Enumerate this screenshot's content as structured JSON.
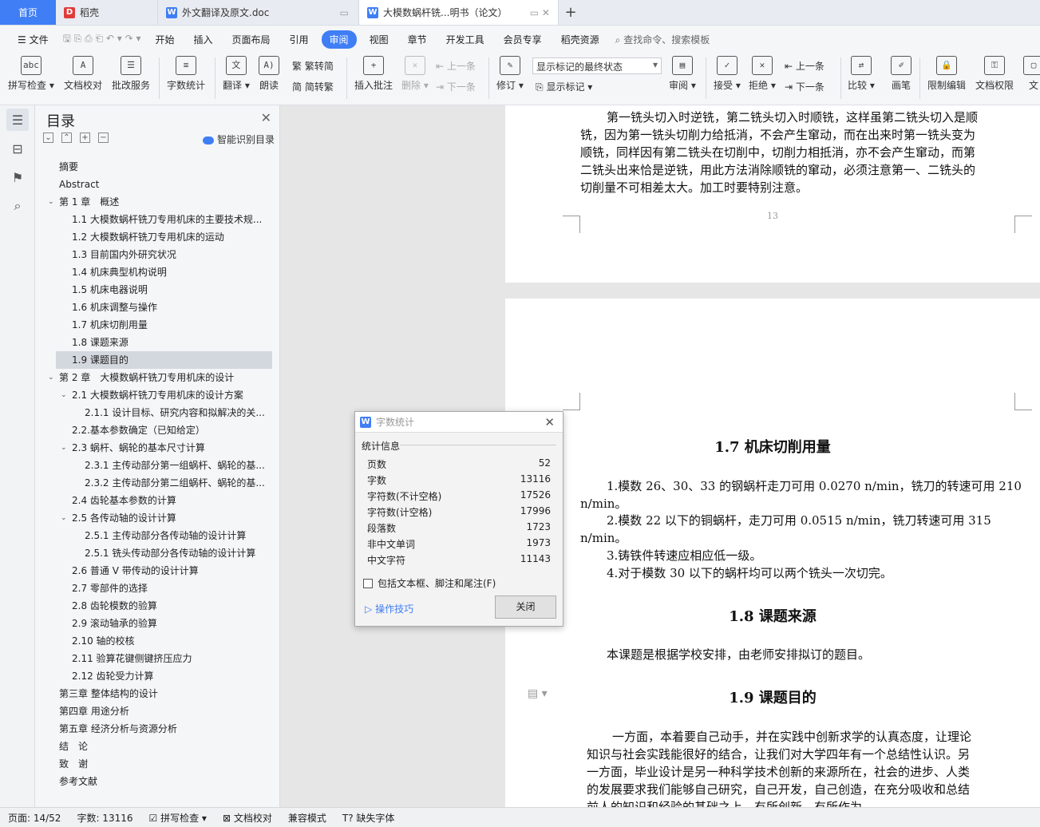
{
  "tabs": {
    "home": "首页",
    "t1": "稻壳",
    "t2": "外文翻译及原文.doc",
    "t3": "大模数蜗杆铣...明书（论文）"
  },
  "menu": [
    "开始",
    "插入",
    "页面布局",
    "引用",
    "审阅",
    "视图",
    "章节",
    "开发工具",
    "会员专享",
    "稻壳资源"
  ],
  "menu_file": "文件",
  "menu_active": "审阅",
  "search_text": "查找命令、搜索模板",
  "toolbar": {
    "spell": "拼写检查",
    "proof": "文档校对",
    "batch": "批改服务",
    "wordcount": "字数统计",
    "translate": "翻译",
    "read": "朗读",
    "trad": "繁转简",
    "simp": "简转繁",
    "insert_comment": "插入批注",
    "delete": "删除",
    "prev": "上一条",
    "next": "下一条",
    "revise": "修订",
    "display_select": "显示标记的最终状态",
    "show_marks": "显示标记",
    "review": "审阅",
    "accept": "接受",
    "reject": "拒绝",
    "prev2": "上一条",
    "next2": "下一条",
    "compare": "比较",
    "ink": "画笔",
    "restrict": "限制编辑",
    "perm": "文档权限",
    "more": "文"
  },
  "toc": {
    "title": "目录",
    "smart": "智能识别目录",
    "items": [
      {
        "t": "摘要",
        "lv": 0
      },
      {
        "t": "Abstract",
        "lv": 0
      },
      {
        "t": "第 1 章　概述",
        "lv": 0,
        "car": true
      },
      {
        "t": "1.1 大模数蜗杆铣刀专用机床的主要技术规...",
        "lv": 1
      },
      {
        "t": "1.2 大模数蜗杆铣刀专用机床的运动",
        "lv": 1
      },
      {
        "t": "1.3 目前国内外研究状况",
        "lv": 1
      },
      {
        "t": "1.4 机床典型机构说明",
        "lv": 1
      },
      {
        "t": "1.5 机床电器说明",
        "lv": 1
      },
      {
        "t": "1.6 机床调整与操作",
        "lv": 1
      },
      {
        "t": "1.7 机床切削用量",
        "lv": 1
      },
      {
        "t": "1.8 课题来源",
        "lv": 1
      },
      {
        "t": "1.9 课题目的",
        "lv": 1,
        "sel": true
      },
      {
        "t": "第 2 章　大模数蜗杆铣刀专用机床的设计",
        "lv": 0,
        "car": true
      },
      {
        "t": "2.1 大模数蜗杆铣刀专用机床的设计方案",
        "lv": 1,
        "car": true
      },
      {
        "t": "2.1.1 设计目标、研究内容和拟解决的关...",
        "lv": 2
      },
      {
        "t": "2.2.基本参数确定（已知给定）",
        "lv": 1
      },
      {
        "t": "2.3 蜗杆、蜗轮的基本尺寸计算",
        "lv": 1,
        "car": true
      },
      {
        "t": "2.3.1 主传动部分第一组蜗杆、蜗轮的基...",
        "lv": 2
      },
      {
        "t": "2.3.2 主传动部分第二组蜗杆、蜗轮的基...",
        "lv": 2
      },
      {
        "t": "2.4 齿轮基本参数的计算",
        "lv": 1
      },
      {
        "t": "2.5 各传动轴的设计计算",
        "lv": 1,
        "car": true
      },
      {
        "t": "2.5.1 主传动部分各传动轴的设计计算",
        "lv": 2
      },
      {
        "t": "2.5.1 铣头传动部分各传动轴的设计计算",
        "lv": 2
      },
      {
        "t": "2.6 普通 V 带传动的设计计算",
        "lv": 1
      },
      {
        "t": "2.7 零部件的选择",
        "lv": 1
      },
      {
        "t": "2.8 齿轮模数的验算",
        "lv": 1
      },
      {
        "t": "2.9 滚动轴承的验算",
        "lv": 1
      },
      {
        "t": "2.10 轴的校核",
        "lv": 1
      },
      {
        "t": "2.11 验算花键侧键挤压应力",
        "lv": 1
      },
      {
        "t": "2.12 齿轮受力计算",
        "lv": 1
      },
      {
        "t": "第三章 整体结构的设计",
        "lv": 0
      },
      {
        "t": "第四章 用途分析",
        "lv": 0
      },
      {
        "t": "第五章 经济分析与资源分析",
        "lv": 0
      },
      {
        "t": "结　论",
        "lv": 0
      },
      {
        "t": "致　谢",
        "lv": 0
      },
      {
        "t": "参考文献",
        "lv": 0
      }
    ]
  },
  "doc": {
    "p1_lines": [
      "第一铣头切入时逆铣，第二铣头切入时顺铣，这样虽第二铣头切入是顺",
      "铣，因为第一铣头切削力给抵消，不会产生窜动，而在出来时第一铣头变为",
      "顺铣，同样因有第二铣头在切削中，切削力相抵消，亦不会产生窜动，而第",
      "二铣头出来恰是逆铣，用此方法消除顺铣的窜动，必须注意第一、二铣头的",
      "切削量不可相差太大。加工时要特别注意。"
    ],
    "page_number": "13",
    "h17": "1.7 机床切削用量",
    "l1a": "1.模数 26、30、33 的钢蜗杆走刀可用 0.0270 n/min，铣刀的转速可用 210",
    "l1b": "n/min。",
    "l2a": "2.模数 22 以下的铜蜗杆，走刀可用 0.0515 n/min，铣刀转速可用 315",
    "l2b": "n/min。",
    "l3": "3.铸铁件转速应相应低一级。",
    "l4": "4.对于模数 30 以下的蜗杆均可以两个铣头一次切完。",
    "h18": "1.8 课题来源",
    "p18": "本课题是根据学校安排，由老师安排拟订的题目。",
    "h19": "1.9 课题目的",
    "p19_lines": [
      "一方面，本着要自己动手，并在实践中创新求学的认真态度，让理论",
      "知识与社会实践能很好的结合，让我们对大学四年有一个总结性认识。另",
      "一方面，毕业设计是另一种科学技术创新的来源所在，社会的进步、人类",
      "的发展要求我们能够自己研究，自己开发，自己创造，在充分吸收和总结",
      "前人的知识和经验的基础之上，有所创新，有所作为。"
    ]
  },
  "dialog": {
    "title": "字数统计",
    "section": "统计信息",
    "rows": [
      {
        "k": "页数",
        "v": "52"
      },
      {
        "k": "字数",
        "v": "13116"
      },
      {
        "k": "字符数(不计空格)",
        "v": "17526"
      },
      {
        "k": "字符数(计空格)",
        "v": "17996"
      },
      {
        "k": "段落数",
        "v": "1723"
      },
      {
        "k": "非中文单词",
        "v": "1973"
      },
      {
        "k": "中文字符",
        "v": "11143"
      }
    ],
    "checkbox": "包括文本框、脚注和尾注(F)",
    "tips": "操作技巧",
    "close": "关闭"
  },
  "status": {
    "page": "页面: 14/52",
    "words": "字数: 13116",
    "spell": "拼写检查",
    "proof": "文档校对",
    "compat": "兼容模式",
    "missing": "缺失字体"
  },
  "colors": {
    "accent": "#3f7ef5"
  }
}
